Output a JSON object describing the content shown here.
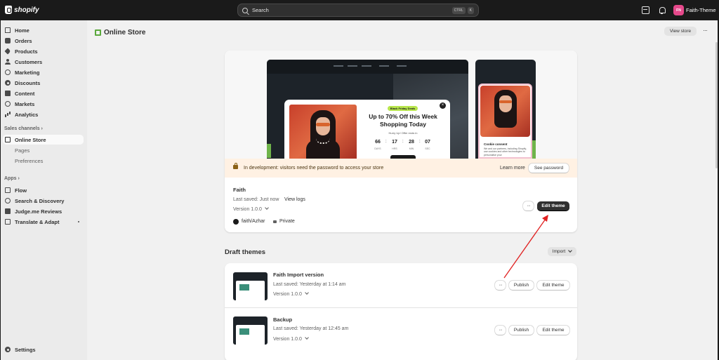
{
  "topbar": {
    "brand": "shopify",
    "search_placeholder": "Search",
    "shortcut_ctrl": "CTRL",
    "shortcut_k": "K",
    "avatar_initials": "FN",
    "account_name": "Faith-Theme"
  },
  "sidebar": {
    "items": [
      {
        "label": "Home",
        "icon": "home-icon"
      },
      {
        "label": "Orders",
        "icon": "inbox-icon"
      },
      {
        "label": "Products",
        "icon": "tag-icon"
      },
      {
        "label": "Customers",
        "icon": "person-icon"
      },
      {
        "label": "Marketing",
        "icon": "target-icon"
      },
      {
        "label": "Discounts",
        "icon": "discount-icon"
      },
      {
        "label": "Content",
        "icon": "folder-icon"
      },
      {
        "label": "Markets",
        "icon": "globe-icon"
      },
      {
        "label": "Analytics",
        "icon": "bar-chart-icon"
      }
    ],
    "sales_channels_label": "Sales channels",
    "online_store": "Online Store",
    "online_store_sub": [
      "Pages",
      "Preferences"
    ],
    "apps_label": "Apps",
    "apps": [
      "Flow",
      "Search & Discovery",
      "Judge.me Reviews",
      "Translate & Adapt"
    ],
    "settings": "Settings"
  },
  "header": {
    "title": "Online Store",
    "view_store": "View store"
  },
  "preview": {
    "badge": "Black Friday Deals",
    "headline": "Up to 70% Off this Week Shopping Today",
    "note": "Hurry Up! Offer ends in",
    "countdown": [
      {
        "value": "66",
        "unit": "DAYS"
      },
      {
        "value": "17",
        "unit": "HRS"
      },
      {
        "value": "28",
        "unit": "MIN"
      },
      {
        "value": "07",
        "unit": "SEC"
      }
    ],
    "cookie_title": "Cookie consent",
    "cookie_text": "We and our partners, including Shopify, use cookies and other technologies to personalise your"
  },
  "banner": {
    "text": "In development: visitors need the password to access your store",
    "learn_more": "Learn more",
    "see_password": "See password"
  },
  "live_theme": {
    "name": "Faith",
    "last_saved": "Last saved: Just now",
    "view_logs": "View logs",
    "version": "Version 1.0.0",
    "repo": "faith/Azhar",
    "visibility": "Private",
    "edit_button": "Edit theme"
  },
  "drafts": {
    "title": "Draft themes",
    "import_button": "Import",
    "items": [
      {
        "name": "Faith Import version",
        "last_saved": "Last saved: Yesterday at 1:14 am",
        "version": "Version 1.0.0",
        "publish": "Publish",
        "edit": "Edit theme"
      },
      {
        "name": "Backup",
        "last_saved": "Last saved: Yesterday at 12:45 am",
        "version": "Version 1.0.0",
        "publish": "Publish",
        "edit": "Edit theme"
      }
    ]
  },
  "colors": {
    "topbar": "#1a1a1a",
    "dark_button": "#303030",
    "banner_bg": "#fff1e3",
    "annotation_arrow": "#e02020"
  }
}
